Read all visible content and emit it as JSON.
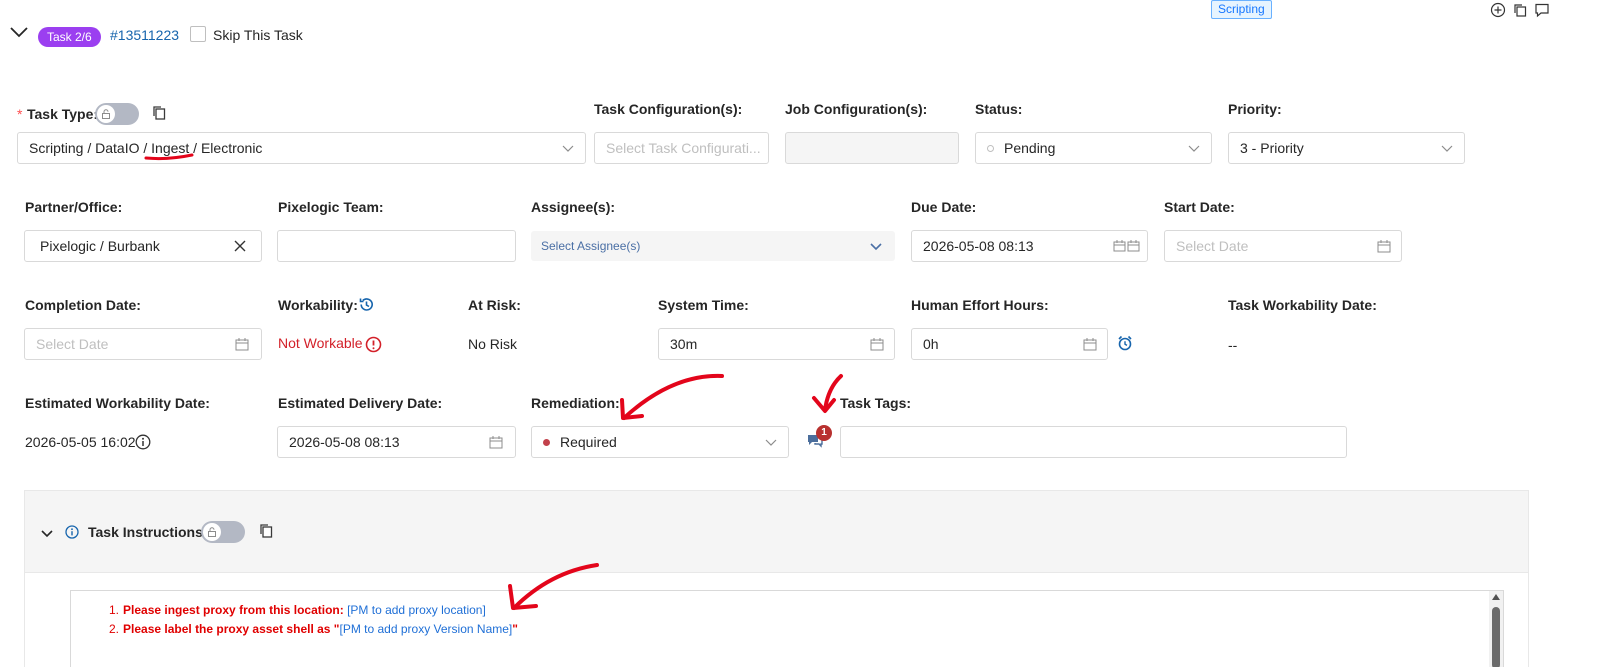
{
  "header": {
    "task_badge": "Task 2/6",
    "task_id": "#13511223",
    "skip_label": "Skip This Task",
    "category_badge": "Scripting"
  },
  "row1": {
    "task_type_required": "*",
    "task_type_label": "Task Type:",
    "task_type_value": "Scripting / DataIO / Ingest / Electronic",
    "task_config_label": "Task Configuration(s):",
    "task_config_placeholder": "Select Task Configurati...",
    "job_config_label": "Job Configuration(s):",
    "status_label": "Status:",
    "status_value": "Pending",
    "priority_label": "Priority:",
    "priority_value": "3 - Priority"
  },
  "row2": {
    "partner_label": "Partner/Office:",
    "partner_value": "Pixelogic / Burbank",
    "team_label": "Pixelogic Team:",
    "assignee_label": "Assignee(s):",
    "assignee_placeholder": "Select Assignee(s)",
    "due_label": "Due Date:",
    "due_value": "2026-05-08 08:13",
    "start_label": "Start Date:",
    "start_placeholder": "Select Date"
  },
  "row3": {
    "completion_label": "Completion Date:",
    "completion_placeholder": "Select Date",
    "workability_label": "Workability:",
    "workability_value": "Not Workable",
    "at_risk_label": "At Risk:",
    "at_risk_value": "No Risk",
    "system_time_label": "System Time:",
    "system_time_value": "30m",
    "human_effort_label": "Human Effort Hours:",
    "human_effort_value": "0h",
    "task_workability_label": "Task Workability Date:",
    "task_workability_value": "--"
  },
  "row4": {
    "est_workability_label": "Estimated Workability Date:",
    "est_workability_value": "2026-05-05 16:02",
    "est_delivery_label": "Estimated Delivery Date:",
    "est_delivery_value": "2026-05-08 08:13",
    "remediation_label": "Remediation:",
    "remediation_value": "Required",
    "comment_count": "1",
    "task_tags_label": "Task Tags:"
  },
  "instructions": {
    "title": "Task Instructions",
    "line1_num": "1.",
    "line1_text": "Please ingest proxy from this location: ",
    "line1_link": "[PM to add proxy location]",
    "line2_num": "2.",
    "line2_text": "Please label the proxy asset shell as ",
    "line2_q1": "\"",
    "line2_link": "[PM to add proxy Version Name]",
    "line2_q2": "\""
  },
  "colors": {
    "badge_purple": "#9b3ff0",
    "link_blue": "#1765ad",
    "error_red": "#d32029",
    "annotation_red": "#e3051b",
    "instruction_red": "#e00000",
    "instruction_blue": "#1f6fd6"
  }
}
